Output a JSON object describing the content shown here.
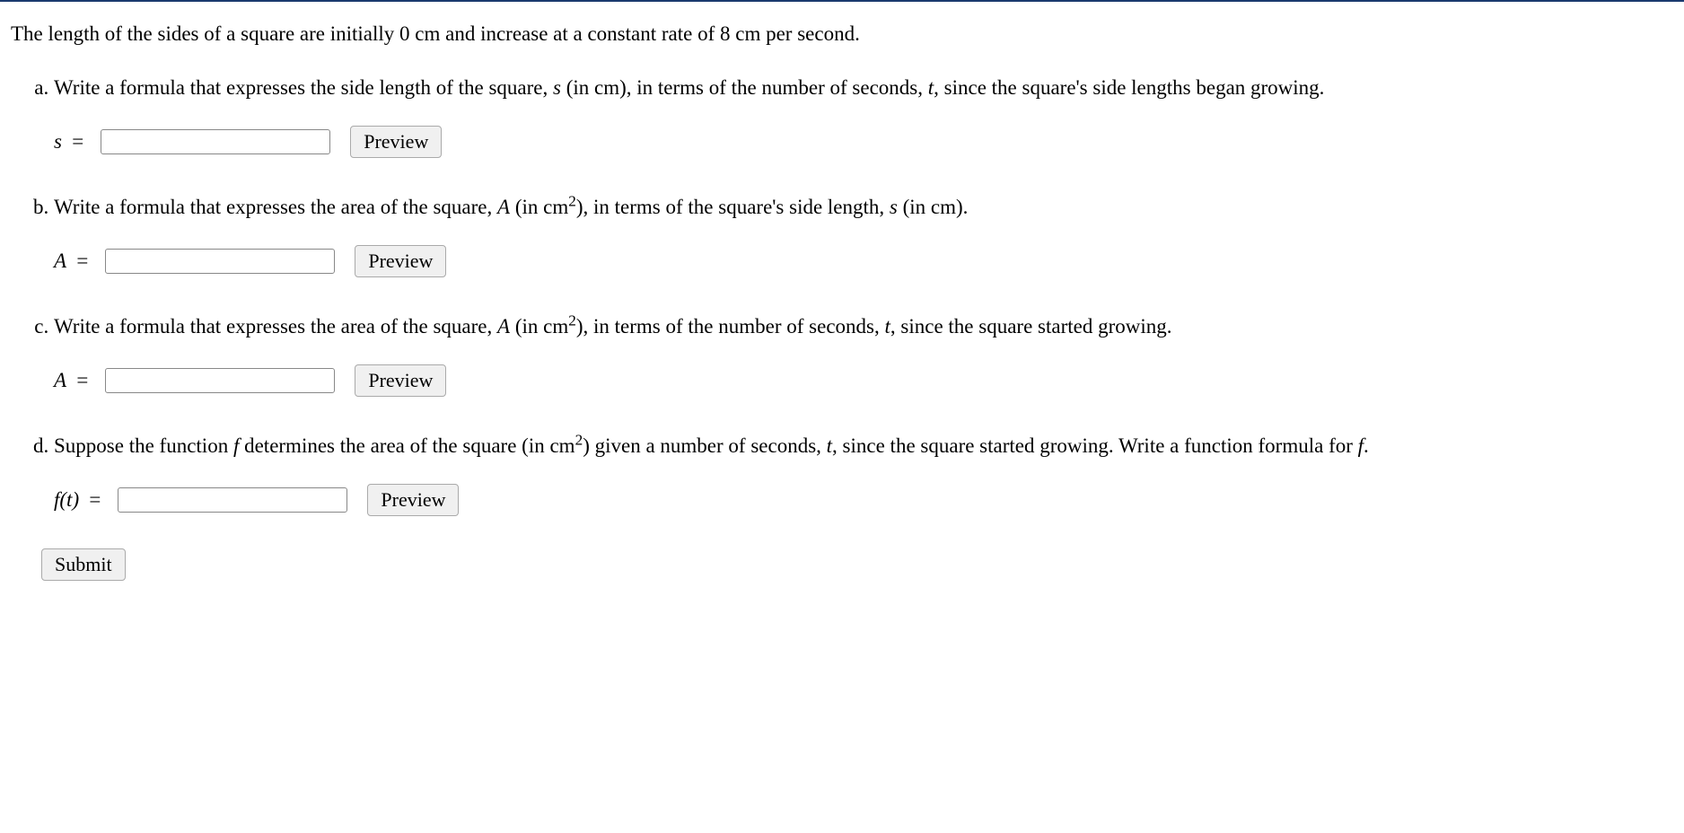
{
  "intro": "The length of the sides of a square are initially 0 cm and increase at a constant rate of 8 cm per second.",
  "parts": {
    "a": {
      "text_before": "Write a formula that expresses the side length of the square, ",
      "var1": "s",
      "text_mid1": " (in cm), in terms of the number of seconds, ",
      "var2": "t",
      "text_after": ", since the square's side lengths began growing.",
      "label_var": "s",
      "label_eq": " = ",
      "input_value": "",
      "preview_label": "Preview"
    },
    "b": {
      "text_before": "Write a formula that expresses the area of the square, ",
      "var1": "A",
      "text_mid1": " (in cm",
      "sup1": "2",
      "text_mid2": "), in terms of the square's side length, ",
      "var2": "s",
      "text_after": " (in cm).",
      "label_var": "A",
      "label_eq": " = ",
      "input_value": "",
      "preview_label": "Preview"
    },
    "c": {
      "text_before": "Write a formula that expresses the area of the square, ",
      "var1": "A",
      "text_mid1": " (in cm",
      "sup1": "2",
      "text_mid2": "), in terms of the number of seconds, ",
      "var2": "t",
      "text_after": ", since the square started growing.",
      "label_var": "A",
      "label_eq": " = ",
      "input_value": "",
      "preview_label": "Preview"
    },
    "d": {
      "text_before": "Suppose the function ",
      "var1": "f",
      "text_mid1": " determines the area of the square (in cm",
      "sup1": "2",
      "text_mid2": ") given a number of seconds, ",
      "var2": "t",
      "text_after": ", since the square started growing. Write a function formula for ",
      "var3": "f",
      "text_end": ".",
      "label_full": "f(t)",
      "label_eq": " = ",
      "input_value": "",
      "preview_label": "Preview"
    }
  },
  "submit_label": "Submit"
}
